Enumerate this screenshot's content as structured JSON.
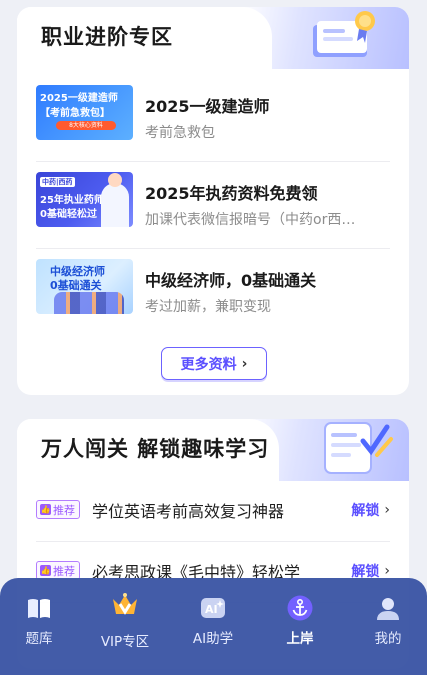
{
  "career_card": {
    "title": "职业进阶专区",
    "items": [
      {
        "title": "2025一级建造师",
        "subtitle": "考前急救包",
        "thumb_line1": "2025一级建造师",
        "thumb_line2": "【考前急救包】",
        "thumb_chip": "8大核心资料"
      },
      {
        "title": "2025年执药资料免费领",
        "subtitle": "加课代表微信报暗号（中药or西…",
        "thumb_line1": "中药|西药",
        "thumb_line2": "25年执业药师",
        "thumb_line3": "0基础轻松过"
      },
      {
        "title": "中级经济师，0基础通关",
        "subtitle": "考过加薪，兼职变现",
        "thumb_line1": "中级经济师",
        "thumb_line2": "0基础通关"
      }
    ],
    "more_label": "更多资料"
  },
  "challenge_card": {
    "title": "万人闯关 解锁趣味学习",
    "items": [
      {
        "badge": "推荐",
        "text": "学位英语考前高效复习神器",
        "action": "解锁"
      },
      {
        "badge": "推荐",
        "text": "必考思政课《毛中特》轻松学",
        "action": "解锁"
      }
    ]
  },
  "tabbar": {
    "items": [
      {
        "label": "题库",
        "icon": "book-icon",
        "active": false
      },
      {
        "label": "VIP专区",
        "icon": "vip-crown-icon",
        "active": false
      },
      {
        "label": "AI助学",
        "icon": "ai-icon",
        "active": false
      },
      {
        "label": "上岸",
        "icon": "anchor-icon",
        "active": true
      },
      {
        "label": "我的",
        "icon": "user-icon",
        "active": false
      }
    ]
  },
  "colors": {
    "accent": "#5b4fff",
    "badge": "#9b59ff",
    "tabbar": "#3d57a6"
  }
}
